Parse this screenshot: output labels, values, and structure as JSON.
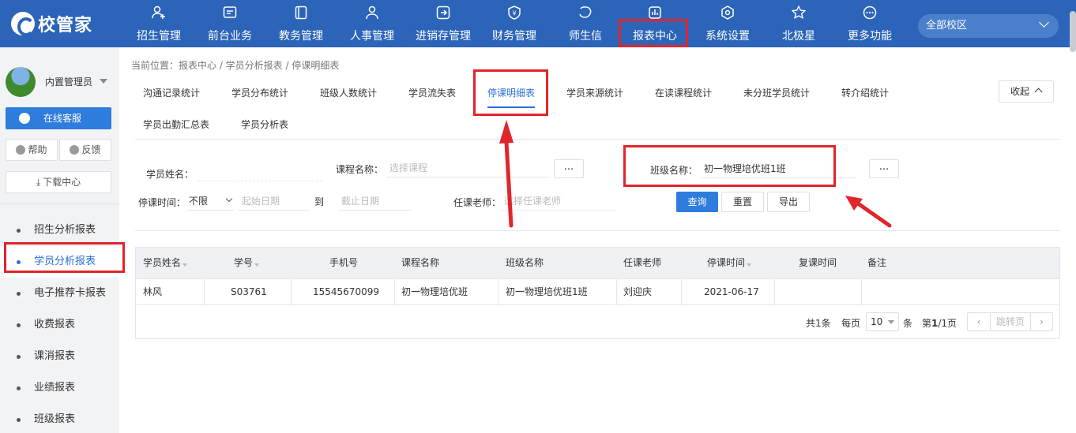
{
  "app": {
    "logo_text": "校管家"
  },
  "nav": [
    {
      "label": "招生管理",
      "icon": "person-add-icon"
    },
    {
      "label": "前台业务",
      "icon": "screen-icon"
    },
    {
      "label": "教务管理",
      "icon": "book-icon"
    },
    {
      "label": "人事管理",
      "icon": "person-icon"
    },
    {
      "label": "进销存管理",
      "icon": "arrow-box-icon"
    },
    {
      "label": "财务管理",
      "icon": "yen-shield-icon"
    },
    {
      "label": "师生信",
      "icon": "chat-icon"
    },
    {
      "label": "报表中心",
      "icon": "report-icon"
    },
    {
      "label": "系统设置",
      "icon": "settings-icon"
    },
    {
      "label": "北极星",
      "icon": "star-icon"
    },
    {
      "label": "更多功能",
      "icon": "more-icon"
    }
  ],
  "campus": {
    "label": "全部校区"
  },
  "user": {
    "name": "内置管理员"
  },
  "sidebar": {
    "online_service": "在线客服",
    "help": "帮助",
    "feedback": "反馈",
    "download": "下载中心",
    "menu": [
      "招生分析报表",
      "学员分析报表",
      "电子推荐卡报表",
      "收费报表",
      "课消报表",
      "业绩报表",
      "班级报表"
    ]
  },
  "breadcrumb": "当前位置：报表中心 / 学员分析报表 / 停课明细表",
  "tabs": [
    "沟通记录统计",
    "学员分布统计",
    "班级人数统计",
    "学员流失表",
    "停课明细表",
    "学员来源统计",
    "在读课程统计",
    "未分班学员统计",
    "转介绍统计",
    "学员出勤汇总表",
    "学员分析表"
  ],
  "collapse_label": "收起",
  "filters": {
    "student_name_label": "学员姓名：",
    "course_label": "课程名称：",
    "course_placeholder": "选择课程",
    "class_label": "班级名称：",
    "class_value": "初一物理培优班1班",
    "ellipsis": "...",
    "suspend_label": "停课时间：",
    "suspend_range": "不限",
    "start_placeholder": "起始日期",
    "to": "到",
    "end_placeholder": "截止日期",
    "teacher_label": "任课老师：",
    "teacher_placeholder": "选择任课老师"
  },
  "buttons": {
    "query": "查询",
    "reset": "重置",
    "export": "导出"
  },
  "table": {
    "headers": [
      "学员姓名",
      "学号",
      "手机号",
      "课程名称",
      "班级名称",
      "任课老师",
      "停课时间",
      "复课时间",
      "备注"
    ],
    "rows": [
      [
        "林风",
        "S03761",
        "15545670099",
        "初一物理培优班",
        "初一物理培优班1班",
        "刘迎庆",
        "2021-06-17",
        "",
        ""
      ]
    ]
  },
  "pagination": {
    "total": "共1条",
    "per_page_prefix": "每页",
    "page_size": "10",
    "per_page_suffix": "条",
    "page_prefix": "第",
    "page_current": "1",
    "page_total": "/1页",
    "jump": "跳转页"
  },
  "colors": {
    "brand": "#2b64b9",
    "accent": "#2e7cdb",
    "highlight": "#e0252b"
  }
}
